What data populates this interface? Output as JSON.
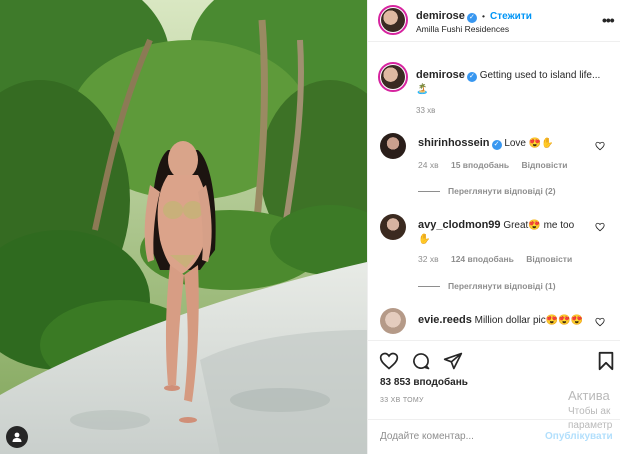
{
  "post": {
    "author": "demirose",
    "follow_label": "Стежити",
    "dot": "•",
    "location": "Amilla Fushi Residences",
    "more_icon": "more-options-icon",
    "caption_text": "Getting used to island life... ",
    "caption_emoji": "🏝️",
    "caption_time": "33 хв",
    "likes": "83 853 вподобань",
    "time_ago": "33 ХВ ТОМУ"
  },
  "comments": [
    {
      "username": "shirinhossein",
      "verified": true,
      "text": "Love ",
      "emoji": "😍✋",
      "time": "24 хв",
      "likes": "15 вподобань",
      "reply_label": "Відповісти",
      "view_replies": "Переглянути відповіді (2)"
    },
    {
      "username": "avy_clodmon99",
      "verified": false,
      "text": "Great",
      "emoji_mid": "😍",
      "text2": " me too",
      "emoji2": "✋",
      "time": "32 хв",
      "likes": "124 вподобань",
      "reply_label": "Відповісти",
      "view_replies": "Переглянути відповіді (1)"
    },
    {
      "username": "evie.reeds",
      "verified": false,
      "text": "Million dollar pic",
      "emoji": "😍😍😍"
    }
  ],
  "add_comment": {
    "placeholder": "Додайте коментар...",
    "publish_label": "Опублікувати"
  },
  "watermark": {
    "line1": "Актива",
    "line2": "Чтобы ак",
    "line3": "параметр"
  },
  "colors": {
    "accent": "#0095f6",
    "verified": "#3897f0",
    "text": "#262626",
    "muted": "#8e8e8e"
  }
}
